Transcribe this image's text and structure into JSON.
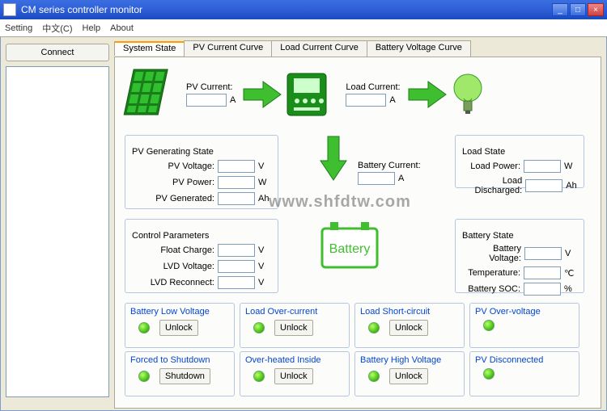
{
  "window": {
    "title": "CM series controller  monitor"
  },
  "menu": {
    "setting": "Setting",
    "chinese": "中文(C)",
    "help": "Help",
    "about": "About"
  },
  "sidebar": {
    "connect": "Connect"
  },
  "tabs": {
    "system": "System State",
    "pv_curve": "PV Current Curve",
    "load_curve": "Load Current Curve",
    "batt_curve": "Battery Voltage Curve"
  },
  "top": {
    "pv_current_label": "PV Current:",
    "pv_current_val": "",
    "pv_current_unit": "A",
    "load_current_label": "Load Current:",
    "load_current_val": "",
    "load_current_unit": "A"
  },
  "pvgen": {
    "legend": "PV Generating State",
    "voltage_lbl": "PV Voltage:",
    "voltage_val": "",
    "voltage_unit": "V",
    "power_lbl": "PV Power:",
    "power_val": "",
    "power_unit": "W",
    "generated_lbl": "PV Generated:",
    "generated_val": "",
    "generated_unit": "Ah"
  },
  "loadst": {
    "legend": "Load State",
    "power_lbl": "Load Power:",
    "power_val": "",
    "power_unit": "W",
    "discharged_lbl": "Load Discharged:",
    "discharged_val": "",
    "discharged_unit": "Ah"
  },
  "battcur": {
    "label": "Battery Current:",
    "val": "",
    "unit": "A"
  },
  "ctrl": {
    "legend": "Control Parameters",
    "float_lbl": "Float Charge:",
    "float_val": "",
    "float_unit": "V",
    "lvd_lbl": "LVD Voltage:",
    "lvd_val": "",
    "lvd_unit": "V",
    "reconn_lbl": "LVD Reconnect:",
    "reconn_val": "",
    "reconn_unit": "V"
  },
  "battst": {
    "legend": "Battery State",
    "voltage_lbl": "Battery Voltage:",
    "voltage_val": "",
    "voltage_unit": "V",
    "temp_lbl": "Temperature:",
    "temp_val": "",
    "temp_unit": "℃",
    "soc_lbl": "Battery SOC:",
    "soc_val": "",
    "soc_unit": "%"
  },
  "battery_graphic_label": "Battery",
  "watermark": "www.shfdtw.com",
  "alarms": {
    "low_v": {
      "title": "Battery Low Voltage",
      "btn": "Unlock"
    },
    "load_oc": {
      "title": "Load Over-current",
      "btn": "Unlock"
    },
    "load_sc": {
      "title": "Load Short-circuit",
      "btn": "Unlock"
    },
    "pv_ov": {
      "title": "PV Over-voltage"
    },
    "forced": {
      "title": "Forced to Shutdown",
      "btn": "Shutdown"
    },
    "overheat": {
      "title": "Over-heated Inside",
      "btn": "Unlock"
    },
    "high_v": {
      "title": "Battery High Voltage",
      "btn": "Unlock"
    },
    "pv_disc": {
      "title": "PV Disconnected"
    }
  }
}
